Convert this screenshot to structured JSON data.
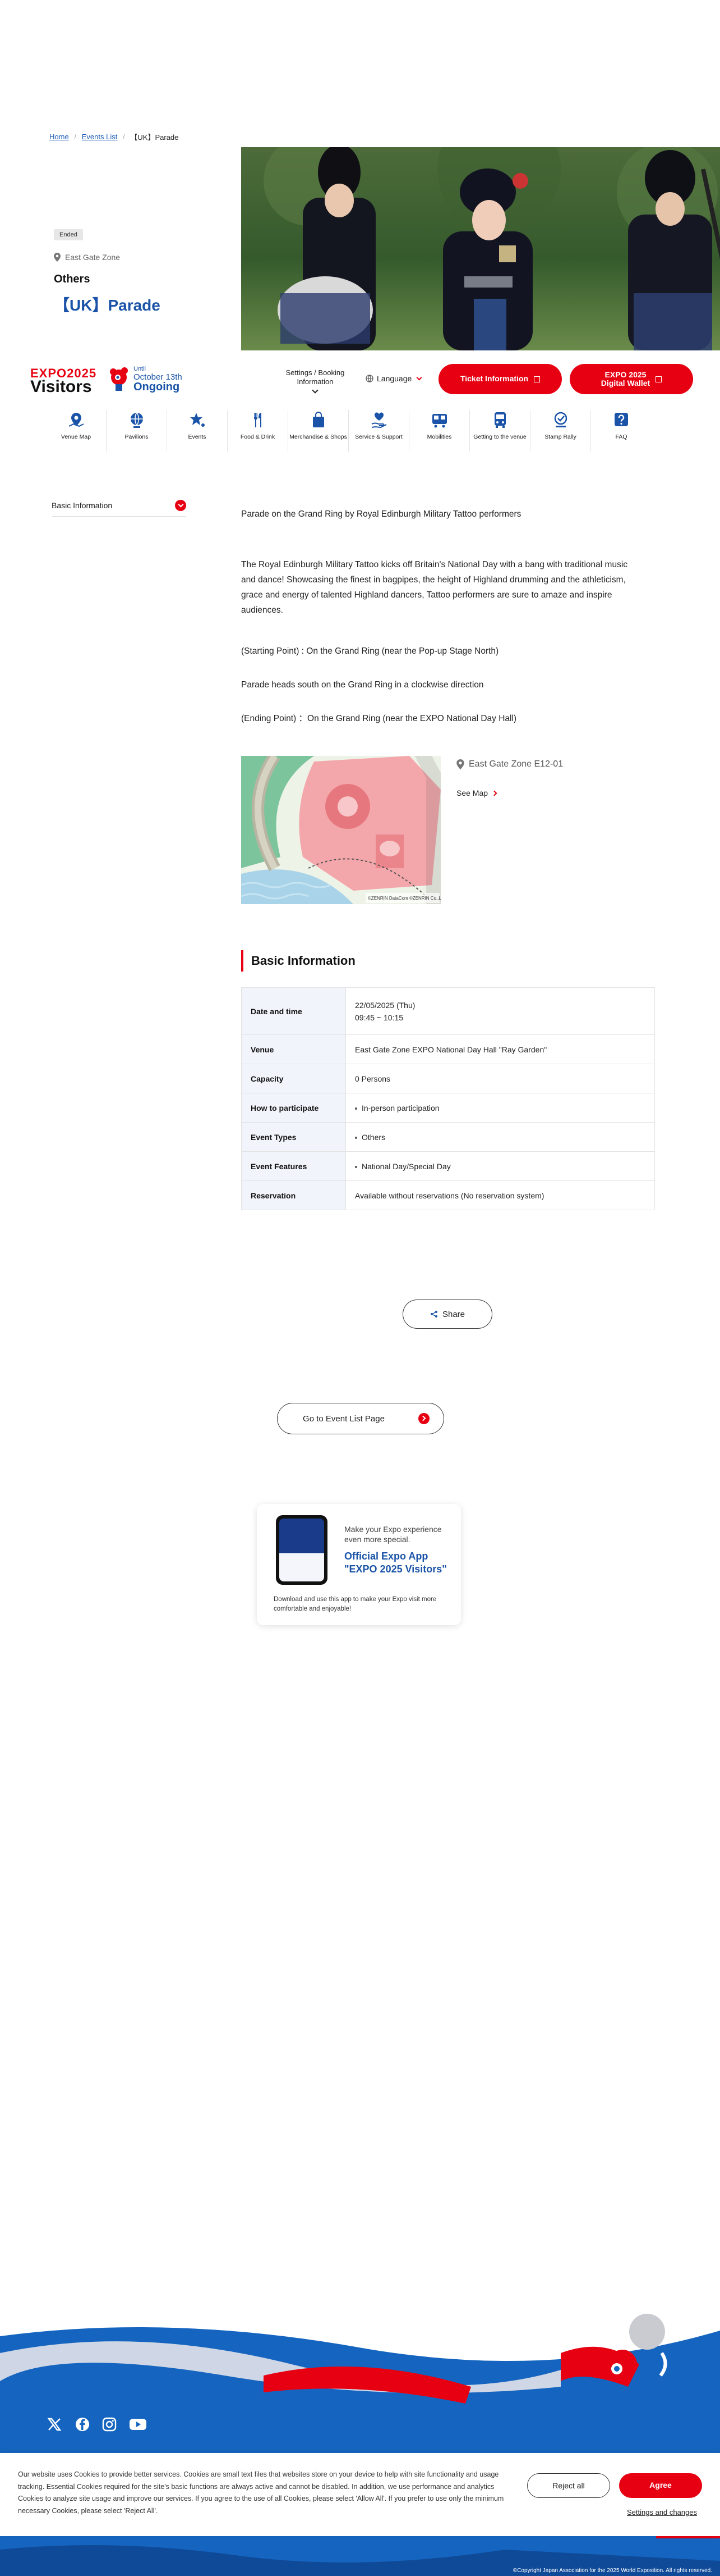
{
  "breadcrumb": {
    "home": "Home",
    "events_list": "Events List",
    "current": "【UK】Parade"
  },
  "hero": {
    "status": "Ended",
    "zone": "East Gate Zone",
    "category": "Others",
    "title": "【UK】Parade"
  },
  "header": {
    "logo_expo": "EXPO2025",
    "logo_visitors": "Visitors",
    "until_small": "Until",
    "until_date": "October 13th",
    "until_state": "Ongoing",
    "settings_line1": "Settings / Booking",
    "settings_line2": "Information",
    "language": "Language",
    "ticket": "Ticket Information",
    "wallet_line1": "EXPO 2025",
    "wallet_line2": "Digital Wallet"
  },
  "nav": [
    {
      "label": "Venue Map",
      "icon": "map-pin-icon"
    },
    {
      "label": "Pavilions",
      "icon": "globe-icon"
    },
    {
      "label": "Events",
      "icon": "star-icon"
    },
    {
      "label": "Food & Drink",
      "icon": "fork-knife-icon"
    },
    {
      "label": "Merchandise & Shops",
      "icon": "shopping-bag-icon"
    },
    {
      "label": "Service & Support",
      "icon": "heart-hand-icon"
    },
    {
      "label": "Mobilities",
      "icon": "train-icon"
    },
    {
      "label": "Getting to the venue",
      "icon": "bus-icon"
    },
    {
      "label": "Stamp Rally",
      "icon": "stamp-icon"
    },
    {
      "label": "FAQ",
      "icon": "question-icon"
    }
  ],
  "side_nav": {
    "basic_info": "Basic Information"
  },
  "description": {
    "lead": "Parade on the Grand Ring by Royal Edinburgh Military Tattoo performers",
    "para": "The Royal Edinburgh Military Tattoo kicks off Britain's National Day with a bang with traditional music and dance! Showcasing the finest in bagpipes, the height of Highland drumming and the athleticism, grace and energy of talented Highland dancers, Tattoo performers are sure to amaze and inspire audiences.",
    "start": "(Starting Point) : On the Grand Ring (near the Pop-up Stage North)",
    "route": "Parade heads south on the Grand Ring in a clockwise direction",
    "end": "(Ending Point) ：On the Grand Ring (near the EXPO National Day Hall)"
  },
  "map": {
    "zone": "East Gate Zone E12-01",
    "see_map": "See Map",
    "credit": "©ZENRIN DataCom ©ZENRIN Co.,LTD. Z24BN"
  },
  "basic_info": {
    "title": "Basic Information",
    "rows": [
      {
        "label": "Date and time",
        "value": "22/05/2025 (Thu)",
        "value2": "09:45 ~ 10:15"
      },
      {
        "label": "Venue",
        "value": "East Gate Zone EXPO National Day Hall \"Ray Garden\""
      },
      {
        "label": "Capacity",
        "value": "0 Persons"
      },
      {
        "label": "How to participate",
        "value": "In-person participation"
      },
      {
        "label": "Event Types",
        "value": "Others"
      },
      {
        "label": "Event Features",
        "value": "National Day/Special Day"
      },
      {
        "label": "Reservation",
        "value": "Available without reservations (No reservation system)"
      }
    ]
  },
  "share": "Share",
  "event_list": "Go to Event List Page",
  "app": {
    "line1": "Make your Expo experience even more special.",
    "line2": "Official Expo App \"EXPO 2025 Visitors\"",
    "desc": "Download and use this app to make your Expo visit more comfortable and enjoyable!"
  },
  "cookie": {
    "text": "Our website uses Cookies to provide better services. Cookies are small text files that websites store on your device to help with site functionality and usage tracking. Essential Cookies required for the site's basic functions are always active and cannot be disabled. In addition, we use performance and analytics Cookies to analyze site usage and improve our services. If you agree to the use of all Cookies, please select 'Allow All'. If you prefer to use only the minimum necessary Cookies, please select 'Reject All'.",
    "reject": "Reject all",
    "agree": "Agree",
    "settings": "Settings and changes"
  },
  "copyright": "©Copyright Japan Association for the 2025 World Exposition. All rights reserved.",
  "colors": {
    "accent_red": "#e60012",
    "brand_blue": "#1a53a8",
    "footer_blue": "#1565c0"
  }
}
